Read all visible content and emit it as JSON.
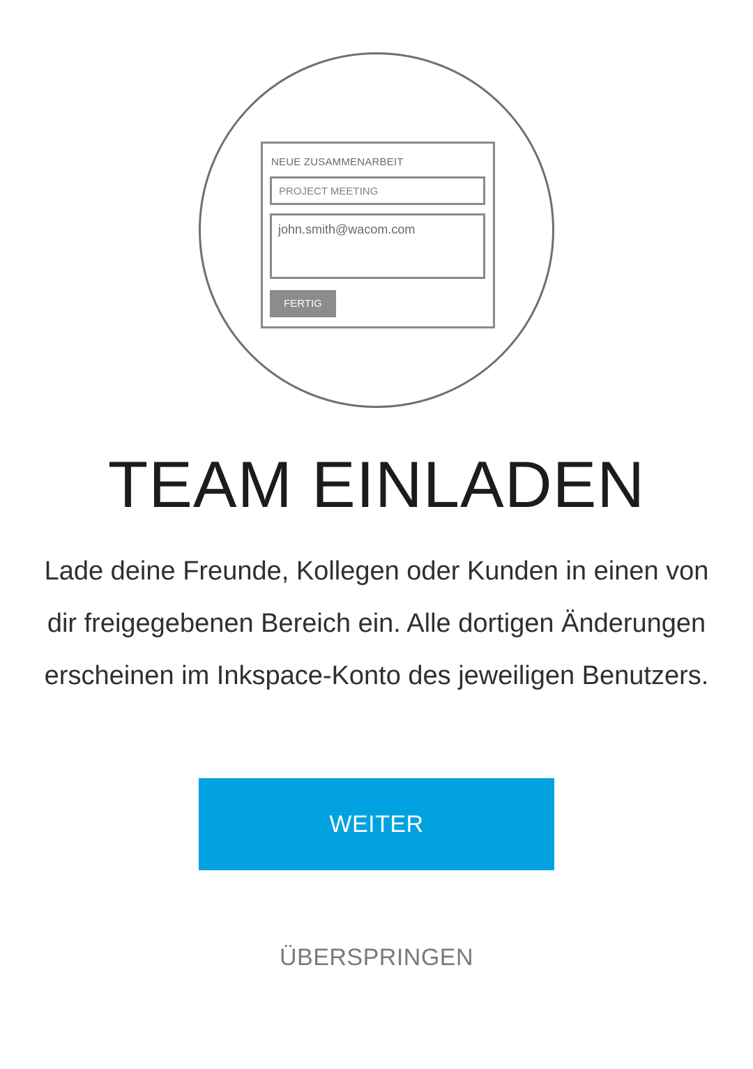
{
  "illustration": {
    "heading": "NEUE ZUSAMMENARBEIT",
    "title_field_value": "PROJECT MEETING",
    "email_field_value": "john.smith@wacom.com",
    "button_label": "FERTIG"
  },
  "main": {
    "title": "TEAM EINLADEN",
    "description": "Lade deine Freunde, Kollegen oder Kunden in einen von dir freigegebenen Bereich ein. Alle dortigen Änderungen erscheinen im Inkspace-Konto des jeweiligen Benutzers."
  },
  "actions": {
    "continue_label": "WEITER",
    "skip_label": "ÜBERSPRINGEN"
  },
  "colors": {
    "accent": "#02a2e0",
    "title_text": "#1c1c1c",
    "body_text": "#2f2f2f",
    "secondary_text": "#7a7a7a"
  }
}
